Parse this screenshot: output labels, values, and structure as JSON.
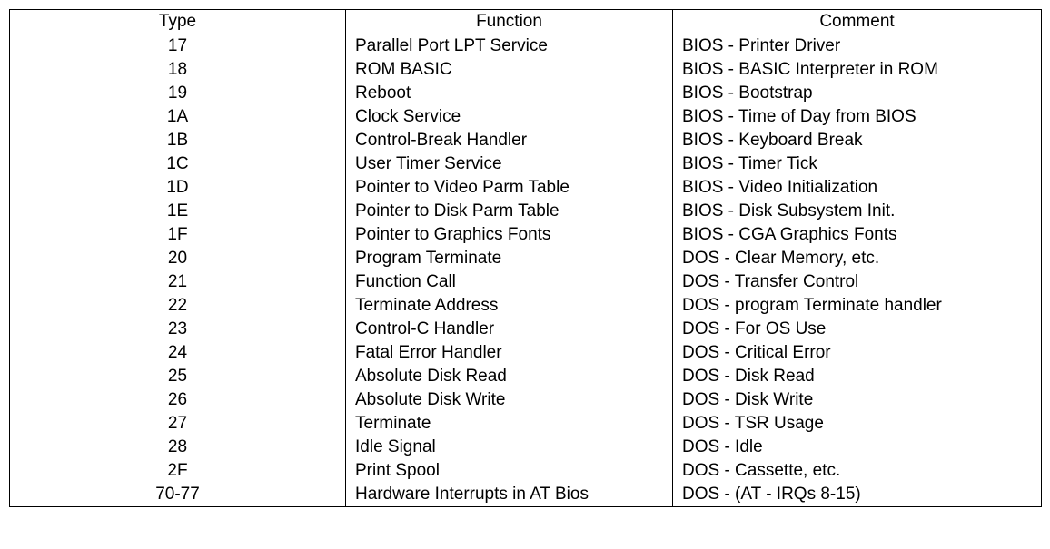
{
  "table": {
    "headers": [
      "Type",
      "Function",
      "Comment"
    ],
    "rows": [
      {
        "type": "17",
        "function": "Parallel Port LPT Service",
        "comment": "BIOS - Printer Driver"
      },
      {
        "type": "18",
        "function": "ROM BASIC",
        "comment": "BIOS - BASIC Interpreter in ROM"
      },
      {
        "type": "19",
        "function": "Reboot",
        "comment": "BIOS - Bootstrap"
      },
      {
        "type": "1A",
        "function": "Clock Service",
        "comment": "BIOS - Time of Day from BIOS"
      },
      {
        "type": "1B",
        "function": "Control-Break Handler",
        "comment": "BIOS - Keyboard Break"
      },
      {
        "type": "1C",
        "function": "User Timer Service",
        "comment": "BIOS - Timer Tick"
      },
      {
        "type": "1D",
        "function": "Pointer to Video Parm Table",
        "comment": "BIOS - Video Initialization"
      },
      {
        "type": "1E",
        "function": "Pointer to Disk Parm Table",
        "comment": "BIOS - Disk Subsystem Init."
      },
      {
        "type": "1F",
        "function": "Pointer to Graphics Fonts",
        "comment": "BIOS - CGA Graphics Fonts"
      },
      {
        "type": "20",
        "function": "Program Terminate",
        "comment": "DOS - Clear Memory, etc."
      },
      {
        "type": "21",
        "function": "Function Call",
        "comment": "DOS - Transfer Control"
      },
      {
        "type": "22",
        "function": "Terminate Address",
        "comment": "DOS - program Terminate handler"
      },
      {
        "type": "23",
        "function": "Control-C Handler",
        "comment": "DOS - For OS Use"
      },
      {
        "type": "24",
        "function": "Fatal Error Handler",
        "comment": "DOS - Critical Error"
      },
      {
        "type": "25",
        "function": "Absolute Disk Read",
        "comment": "DOS - Disk Read"
      },
      {
        "type": "26",
        "function": "Absolute Disk Write",
        "comment": "DOS - Disk Write"
      },
      {
        "type": "27",
        "function": "Terminate",
        "comment": "DOS - TSR Usage"
      },
      {
        "type": "28",
        "function": "Idle Signal",
        "comment": "DOS - Idle"
      },
      {
        "type": "2F",
        "function": "Print Spool",
        "comment": "DOS - Cassette, etc."
      },
      {
        "type": "70-77",
        "function": "Hardware Interrupts in AT Bios",
        "comment": "DOS - (AT - IRQs 8-15)"
      }
    ]
  }
}
